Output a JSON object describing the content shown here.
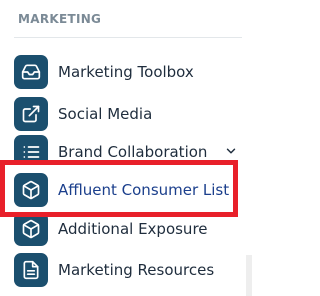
{
  "sidebar": {
    "section_title": "MARKETING",
    "items": [
      {
        "label": "Marketing Toolbox",
        "icon": "inbox-icon"
      },
      {
        "label": "Social Media",
        "icon": "external-link-icon"
      },
      {
        "label": "Brand Collaboration",
        "icon": "list-icon",
        "expandable": true
      },
      {
        "label": "Affluent Consumer List",
        "icon": "cube-icon",
        "highlighted": true
      },
      {
        "label": "Additional Exposure",
        "icon": "cube-icon"
      },
      {
        "label": "Marketing Resources",
        "icon": "document-icon"
      }
    ]
  },
  "colors": {
    "icon_tile": "#1b4f6e",
    "highlight_border": "#e8202a",
    "active_label": "#1b3f8c",
    "section_title": "#7b8a96"
  }
}
